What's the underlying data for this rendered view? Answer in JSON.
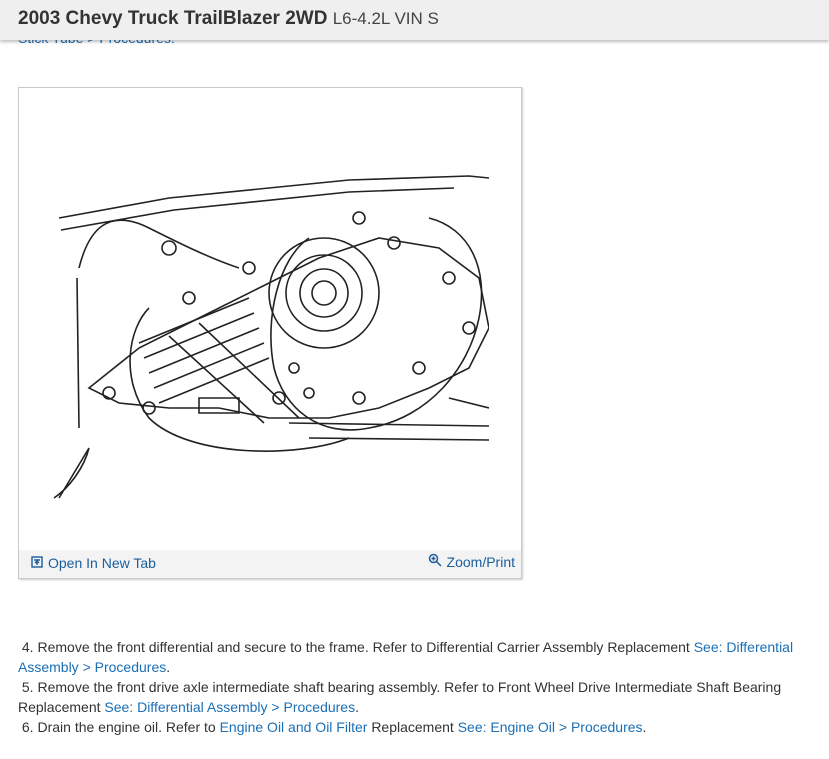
{
  "header": {
    "title": "2003 Chevy Truck TrailBlazer 2WD",
    "engine": "L6-4.2L VIN S"
  },
  "breadcrumb_partial": "Stick Tube > Procedures.",
  "figure": {
    "open_tab_label": "Open In New Tab",
    "zoom_label": "Zoom/Print"
  },
  "steps": [
    {
      "number": "4.",
      "text": "Remove the front differential and secure to the frame. Refer to Differential Carrier Assembly Replacement",
      "link": "See: Differential Assembly > Procedures",
      "end": "."
    },
    {
      "number": "5.",
      "text": "Remove the front drive axle intermediate shaft bearing assembly. Refer to Front Wheel Drive Intermediate Shaft Bearing Replacement",
      "link": "See: Differential Assembly > Procedures",
      "end": "."
    },
    {
      "number": "6.",
      "text_a": "Drain the engine oil. Refer to",
      "link_a": "Engine Oil and Oil Filter",
      "text_b": "Replacement",
      "link_b": "See: Engine Oil > Procedures",
      "end": "."
    }
  ],
  "colors": {
    "link": "#1a6fb5",
    "header_bg": "#efefef",
    "text": "#333333"
  },
  "icons": [
    "open-in-new-tab-icon",
    "zoom-icon"
  ]
}
